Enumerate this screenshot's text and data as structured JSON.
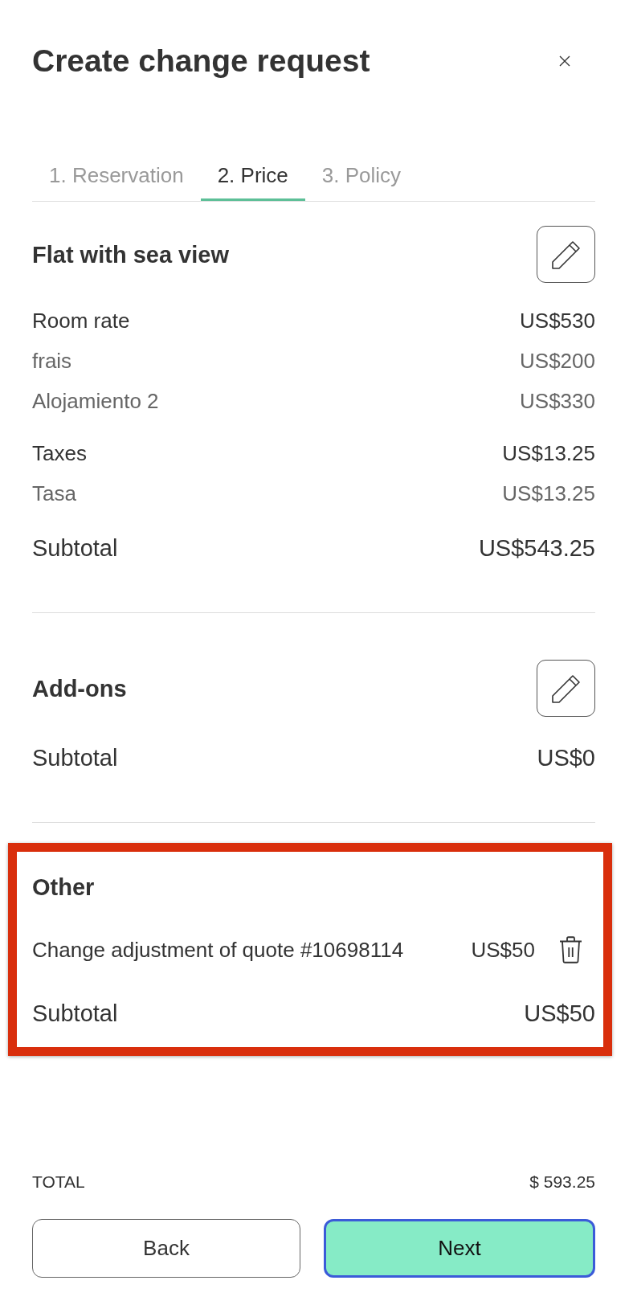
{
  "dialog": {
    "title": "Create change request"
  },
  "tabs": [
    {
      "label": "1. Reservation",
      "selected": false
    },
    {
      "label": "2. Price",
      "selected": true
    },
    {
      "label": "3. Policy",
      "selected": false
    }
  ],
  "sections": [
    {
      "title": "Flat with sea view",
      "editable": true,
      "highlighted": false,
      "lines": [
        {
          "kind": "main",
          "label": "Room rate",
          "amount": "US$530"
        },
        {
          "kind": "sub",
          "label": "frais",
          "amount": "US$200"
        },
        {
          "kind": "sub",
          "label": "Alojamiento 2",
          "amount": "US$330"
        },
        {
          "kind": "main",
          "label": "Taxes",
          "amount": "US$13.25"
        },
        {
          "kind": "sub",
          "label": "Tasa",
          "amount": "US$13.25"
        }
      ],
      "subtotal": {
        "label": "Subtotal",
        "amount": "US$543.25"
      }
    },
    {
      "title": "Add-ons",
      "editable": true,
      "highlighted": false,
      "subtotal": {
        "label": "Subtotal",
        "amount": "US$0"
      }
    },
    {
      "title": "Other",
      "editable": false,
      "highlighted": true,
      "lines": [
        {
          "kind": "removable",
          "label": "Change adjustment of quote #10698114",
          "amount": "US$50"
        }
      ],
      "subtotal": {
        "label": "Subtotal",
        "amount": "US$50"
      }
    }
  ],
  "total": {
    "label": "TOTAL",
    "amount": "$ 593.25"
  },
  "buttons": [
    {
      "label": "Back",
      "kind": "secondary",
      "focused": false
    },
    {
      "label": "Next",
      "kind": "primary",
      "focused": true
    }
  ]
}
